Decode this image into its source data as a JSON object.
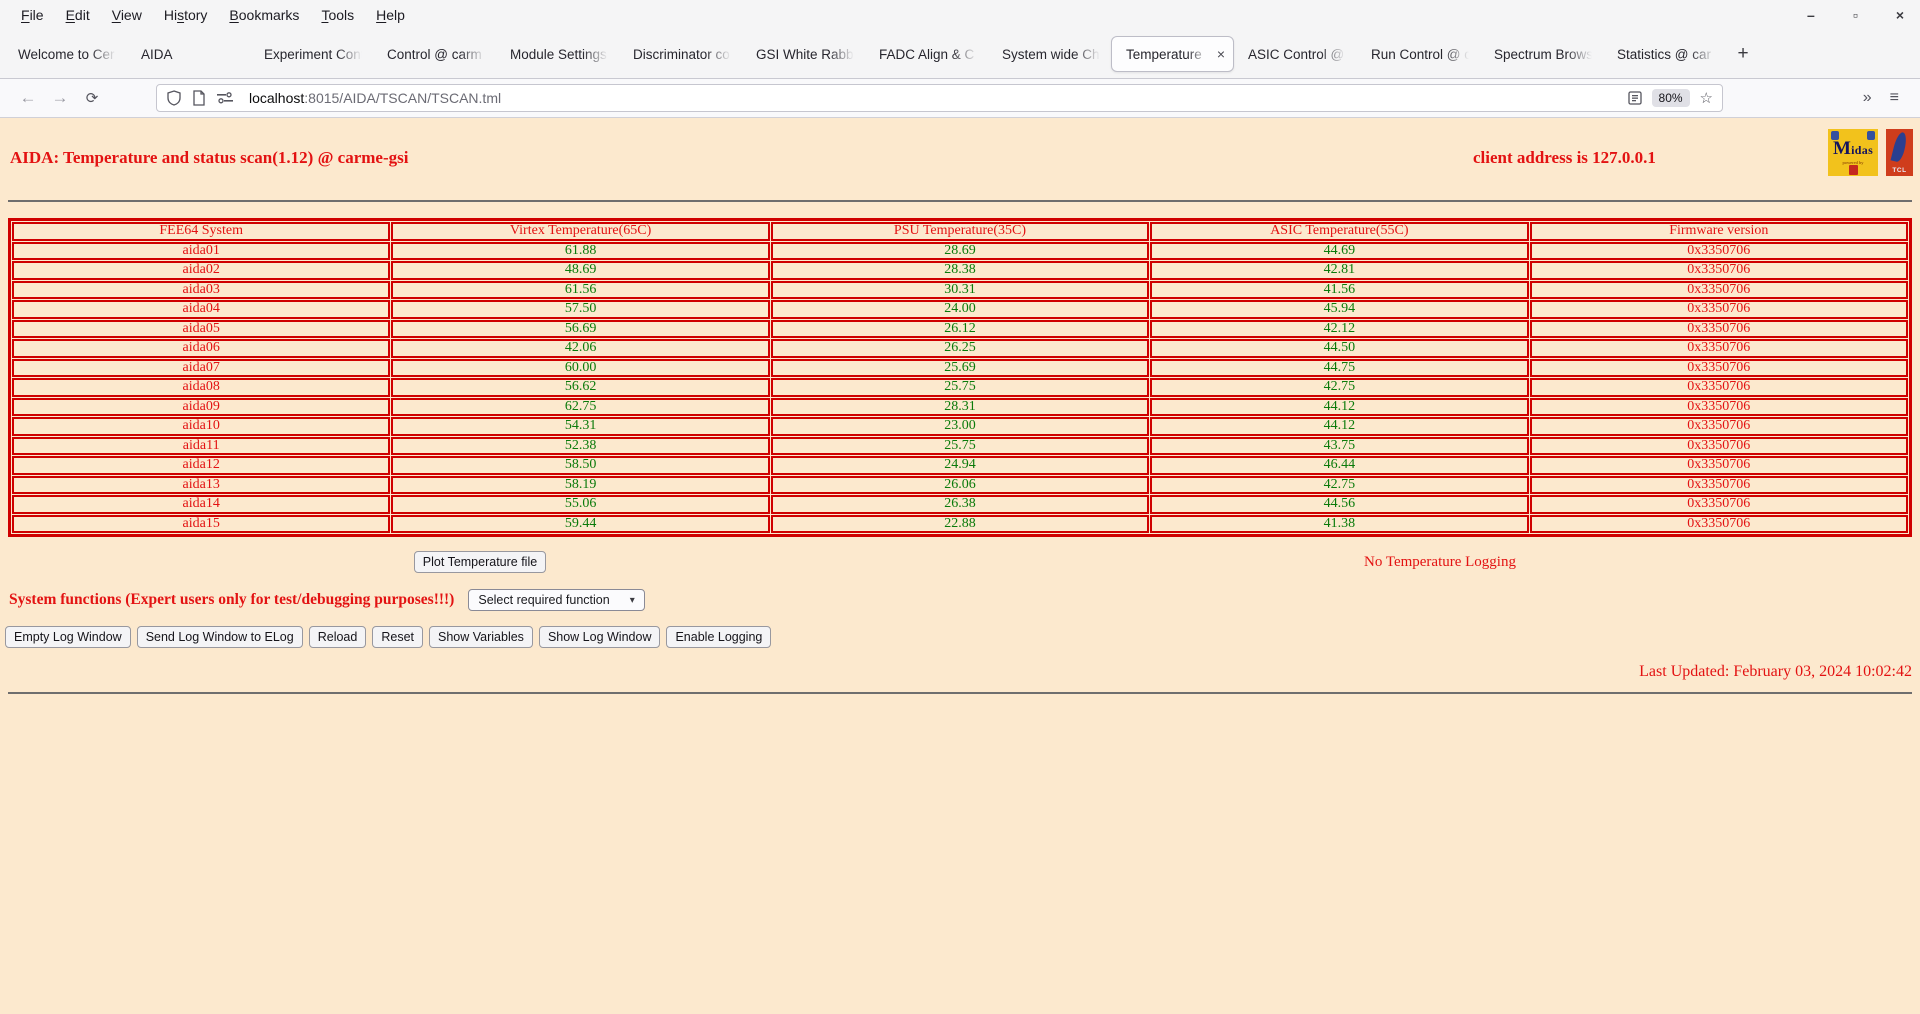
{
  "icons": {
    "back": "←",
    "forward": "→",
    "reload": "⟳",
    "overflow": "»",
    "app_menu": "≡",
    "star": "☆",
    "select_chevron": "▾",
    "tab_close": "×",
    "minimize": "–",
    "maximize": "▫",
    "window_close": "×"
  },
  "menubar": {
    "items": [
      {
        "label": "File",
        "u": 0
      },
      {
        "label": "Edit",
        "u": 0
      },
      {
        "label": "View",
        "u": 0
      },
      {
        "label": "History",
        "u": 2
      },
      {
        "label": "Bookmarks",
        "u": 0
      },
      {
        "label": "Tools",
        "u": 0
      },
      {
        "label": "Help",
        "u": 0
      }
    ]
  },
  "tabbar": {
    "tabs": [
      {
        "label": "Welcome to Cer",
        "active": false
      },
      {
        "label": "AIDA",
        "active": false
      },
      {
        "label": "Experiment Cont",
        "active": false
      },
      {
        "label": "Control @ carm",
        "active": false
      },
      {
        "label": "Module Settings",
        "active": false
      },
      {
        "label": "Discriminator co",
        "active": false
      },
      {
        "label": "GSI White Rabbi",
        "active": false
      },
      {
        "label": "FADC Align & C",
        "active": false
      },
      {
        "label": "System wide Ch",
        "active": false
      },
      {
        "label": "Temperature",
        "active": true
      },
      {
        "label": "ASIC Control @",
        "active": false
      },
      {
        "label": "Run Control @ c",
        "active": false
      },
      {
        "label": "Spectrum Brows",
        "active": false
      },
      {
        "label": "Statistics @ car",
        "active": false
      }
    ],
    "new_tab": "+"
  },
  "navbar": {
    "url_host": "localhost",
    "url_rest": ":8015/AIDA/TSCAN/TSCAN.tml",
    "zoom_badge": "80%"
  },
  "page": {
    "title": "AIDA: Temperature and status scan(1.12) @ carme-gsi",
    "client_address": "client address is 127.0.0.1",
    "logos": {
      "midas_text": "Midas",
      "midas_sub": "powered by",
      "tcl_text": "TCL"
    },
    "table": {
      "headers": [
        "FEE64 System",
        "Virtex Temperature(65C)",
        "PSU Temperature(35C)",
        "ASIC Temperature(55C)",
        "Firmware version"
      ],
      "rows": [
        [
          "aida01",
          "61.88",
          "28.69",
          "44.69",
          "0x3350706"
        ],
        [
          "aida02",
          "48.69",
          "28.38",
          "42.81",
          "0x3350706"
        ],
        [
          "aida03",
          "61.56",
          "30.31",
          "41.56",
          "0x3350706"
        ],
        [
          "aida04",
          "57.50",
          "24.00",
          "45.94",
          "0x3350706"
        ],
        [
          "aida05",
          "56.69",
          "26.12",
          "42.12",
          "0x3350706"
        ],
        [
          "aida06",
          "42.06",
          "26.25",
          "44.50",
          "0x3350706"
        ],
        [
          "aida07",
          "60.00",
          "25.69",
          "44.75",
          "0x3350706"
        ],
        [
          "aida08",
          "56.62",
          "25.75",
          "42.75",
          "0x3350706"
        ],
        [
          "aida09",
          "62.75",
          "28.31",
          "44.12",
          "0x3350706"
        ],
        [
          "aida10",
          "54.31",
          "23.00",
          "44.12",
          "0x3350706"
        ],
        [
          "aida11",
          "52.38",
          "25.75",
          "43.75",
          "0x3350706"
        ],
        [
          "aida12",
          "58.50",
          "24.94",
          "46.44",
          "0x3350706"
        ],
        [
          "aida13",
          "58.19",
          "26.06",
          "42.75",
          "0x3350706"
        ],
        [
          "aida14",
          "55.06",
          "26.38",
          "44.56",
          "0x3350706"
        ],
        [
          "aida15",
          "59.44",
          "22.88",
          "41.38",
          "0x3350706"
        ]
      ]
    },
    "plot_button": "Plot Temperature file",
    "no_logging": "No Temperature Logging",
    "system_functions_label": "System functions (Expert users only for test/debugging purposes!!!)",
    "function_select": "Select required function",
    "action_buttons": [
      "Empty Log Window",
      "Send Log Window to ELog",
      "Reload",
      "Reset",
      "Show Variables",
      "Show Log Window",
      "Enable Logging"
    ],
    "last_updated": "Last Updated: February 03, 2024 10:02:42"
  },
  "colors": {
    "page_bg": "#fce9ce",
    "text_red": "#e31212",
    "value_green": "#0a7a0a",
    "table_border_red": "#cf0000"
  }
}
